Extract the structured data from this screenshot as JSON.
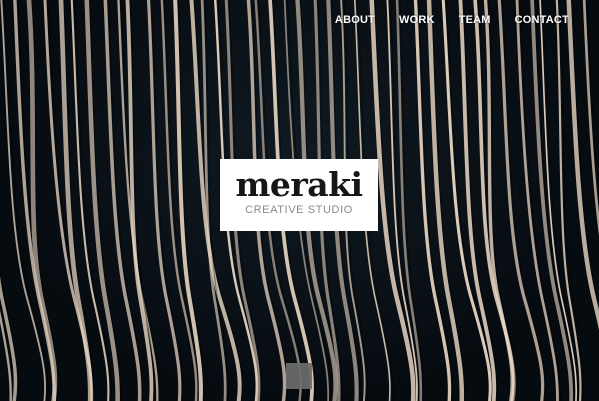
{
  "nav": {
    "items": [
      {
        "label": "ABOUT"
      },
      {
        "label": "WORK"
      },
      {
        "label": "TEAM"
      },
      {
        "label": "CONTACT"
      }
    ]
  },
  "logo": {
    "wordmark": "meraki",
    "tagline": "CREATIVE STUDIO"
  },
  "hero": {
    "background": "abstract-vertical-strands-image",
    "strand_color": "#e9d7c4",
    "base_color": "#0b1218"
  },
  "slider": {
    "indicator_color": "#6c6c6c"
  }
}
